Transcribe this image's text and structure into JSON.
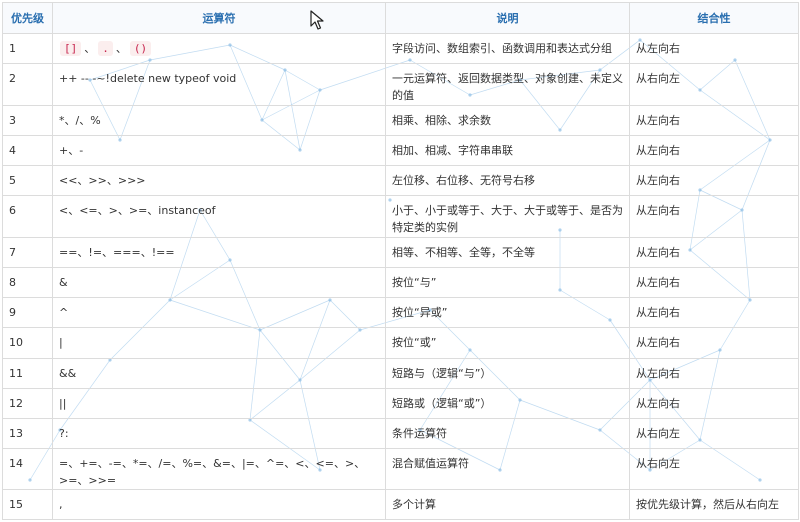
{
  "table": {
    "headers": [
      "优先级",
      "运算符",
      "说明",
      "结合性"
    ],
    "row1_operator_tokens": [
      "[]",
      "、",
      ".",
      "、",
      "()"
    ],
    "rows": [
      {
        "level": "1",
        "operator": "",
        "desc": "字段访问、数组索引、函数调用和表达式分组",
        "assoc": "从左向右"
      },
      {
        "level": "2",
        "operator": "++ -- -~!delete new typeof void",
        "desc": "一元运算符、返回数据类型、对象创建、未定义的值",
        "assoc": "从右向左"
      },
      {
        "level": "3",
        "operator": "*、/、%",
        "desc": "相乘、相除、求余数",
        "assoc": "从左向右"
      },
      {
        "level": "4",
        "operator": "+、-",
        "desc": "相加、相减、字符串串联",
        "assoc": "从左向右"
      },
      {
        "level": "5",
        "operator": "<<、>>、>>>",
        "desc": "左位移、右位移、无符号右移",
        "assoc": "从左向右"
      },
      {
        "level": "6",
        "operator": "<、<=、>、>=、instanceof",
        "desc": "小于、小于或等于、大于、大于或等于、是否为特定类的实例",
        "assoc": "从左向右"
      },
      {
        "level": "7",
        "operator": "==、!=、===、!==",
        "desc": "相等、不相等、全等，不全等",
        "assoc": "从左向右"
      },
      {
        "level": "8",
        "operator": "&",
        "desc": "按位“与”",
        "assoc": "从左向右"
      },
      {
        "level": "9",
        "operator": "^",
        "desc": "按位“异或”",
        "assoc": "从左向右"
      },
      {
        "level": "10",
        "operator": "|",
        "desc": "按位“或”",
        "assoc": "从左向右"
      },
      {
        "level": "11",
        "operator": "&&",
        "desc": "短路与（逻辑“与”）",
        "assoc": "从左向右"
      },
      {
        "level": "12",
        "operator": "||",
        "desc": "短路或（逻辑“或”）",
        "assoc": "从左向右"
      },
      {
        "level": "13",
        "operator": "?:",
        "desc": "条件运算符",
        "assoc": "从右向左"
      },
      {
        "level": "14",
        "operator": "=、+=、-=、*=、/=、%=、&=、|=、^=、<、<=、>、>=、>>=",
        "desc": "混合赋值运算符",
        "assoc": "从右向左"
      },
      {
        "level": "15",
        "operator": ",",
        "desc": "多个计算",
        "assoc": "按优先级计算，然后从右向左"
      }
    ]
  },
  "colors": {
    "header_text": "#2a6fb0",
    "border": "#dcdcdc",
    "code_bg": "#fbeeee",
    "code_text": "#c7254e",
    "background_lines": "#8fbfe6"
  },
  "cursor": {
    "icon": "mouse-pointer-icon"
  }
}
